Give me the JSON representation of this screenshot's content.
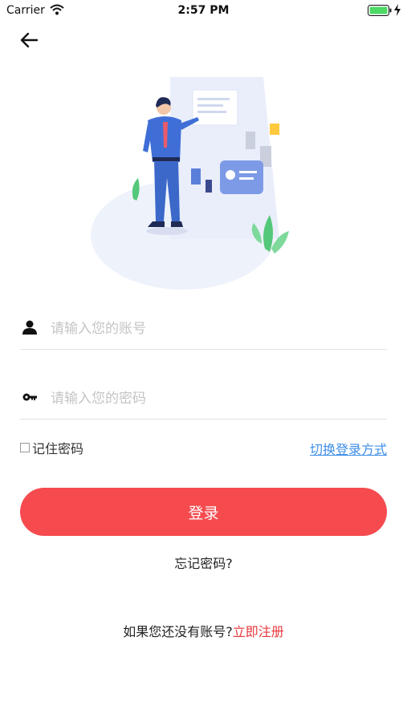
{
  "status_bar": {
    "carrier": "Carrier",
    "time": "2:57 PM",
    "icons": [
      "wifi-icon",
      "battery-icon",
      "charging-bolt-icon"
    ],
    "battery_color": "#4cd964"
  },
  "nav": {
    "back_icon": "arrow-left-icon"
  },
  "illustration": {
    "name": "login-hero-illustration"
  },
  "form": {
    "account": {
      "placeholder": "请输入您的账号",
      "value": "",
      "icon": "user-icon"
    },
    "password": {
      "placeholder": "请输入您的密码",
      "value": "",
      "icon": "key-icon"
    },
    "remember_label": "记住密码",
    "remember_checked": false,
    "switch_login_label": "切换登录方式",
    "login_button": "登录",
    "forgot_password": "忘记密码?"
  },
  "footer": {
    "no_account_text": "如果您还没有账号?",
    "register_link": "立即注册"
  },
  "colors": {
    "primary_red": "#f54b4f",
    "link_red": "#e6393d",
    "link_blue": "#3f8ee8",
    "placeholder_gray": "#c4c4c4"
  }
}
